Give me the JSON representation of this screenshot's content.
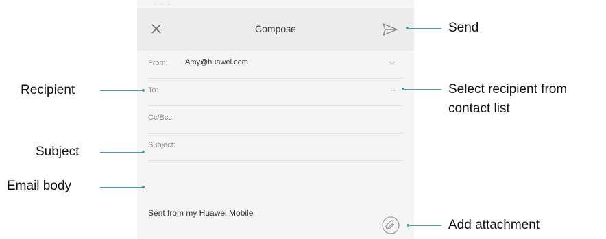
{
  "compose": {
    "title": "Compose",
    "from_label": "From:",
    "from_value": "Amy@huawei.com",
    "to_label": "To:",
    "ccbcc_label": "Cc/Bcc:",
    "subject_label": "Subject:",
    "signature": "Sent from my Huawei Mobile"
  },
  "callouts": {
    "send": "Send",
    "recipient": "Recipient",
    "select_recipient": "Select recipient from contact list",
    "select_recipient_line1": "Select recipient from",
    "select_recipient_line2": "contact list",
    "subject": "Subject",
    "email_body": "Email body",
    "add_attachment": "Add attachment"
  },
  "icons": {
    "close": "close-icon",
    "send": "send-icon",
    "chevron": "chevron-down-icon",
    "plus": "plus-icon",
    "attachment": "attachment-icon"
  },
  "colors": {
    "callout_line": "#3aa69e",
    "titlebar_bg": "#ececec",
    "screen_bg": "#f5f5f5"
  }
}
